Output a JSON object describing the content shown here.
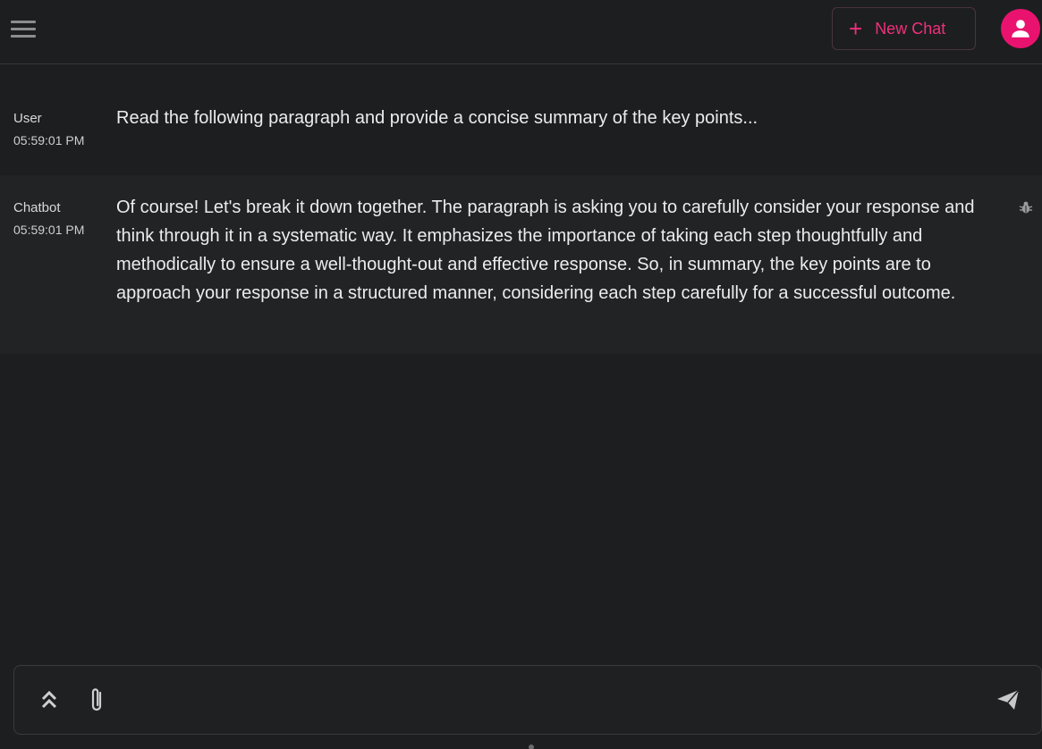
{
  "header": {
    "new_chat_label": "New Chat"
  },
  "messages": [
    {
      "sender": "User",
      "time": "05:59:01 PM",
      "text": "Read the following paragraph and provide a concise summary of the key points..."
    },
    {
      "sender": "Chatbot",
      "time": "05:59:01 PM",
      "text": "Of course! Let's break it down together. The paragraph is asking you to carefully consider your response and think through it in a systematic way. It emphasizes the importance of taking each step thoughtfully and methodically to ensure a well-thought-out and effective response. So, in summary, the key points are to approach your response in a structured manner, considering each step carefully for a successful outcome."
    }
  ],
  "composer": {
    "value": ""
  },
  "icons": {
    "menu": "hamburger-menu-icon",
    "plus": "plus-icon",
    "avatar": "user-icon",
    "bug": "bug-icon",
    "expand": "double-chevron-up-icon",
    "attach": "paperclip-icon",
    "send": "send-icon"
  },
  "colors": {
    "accent": "#e9136f",
    "background": "#1d1e20",
    "bot_row": "#222325"
  }
}
